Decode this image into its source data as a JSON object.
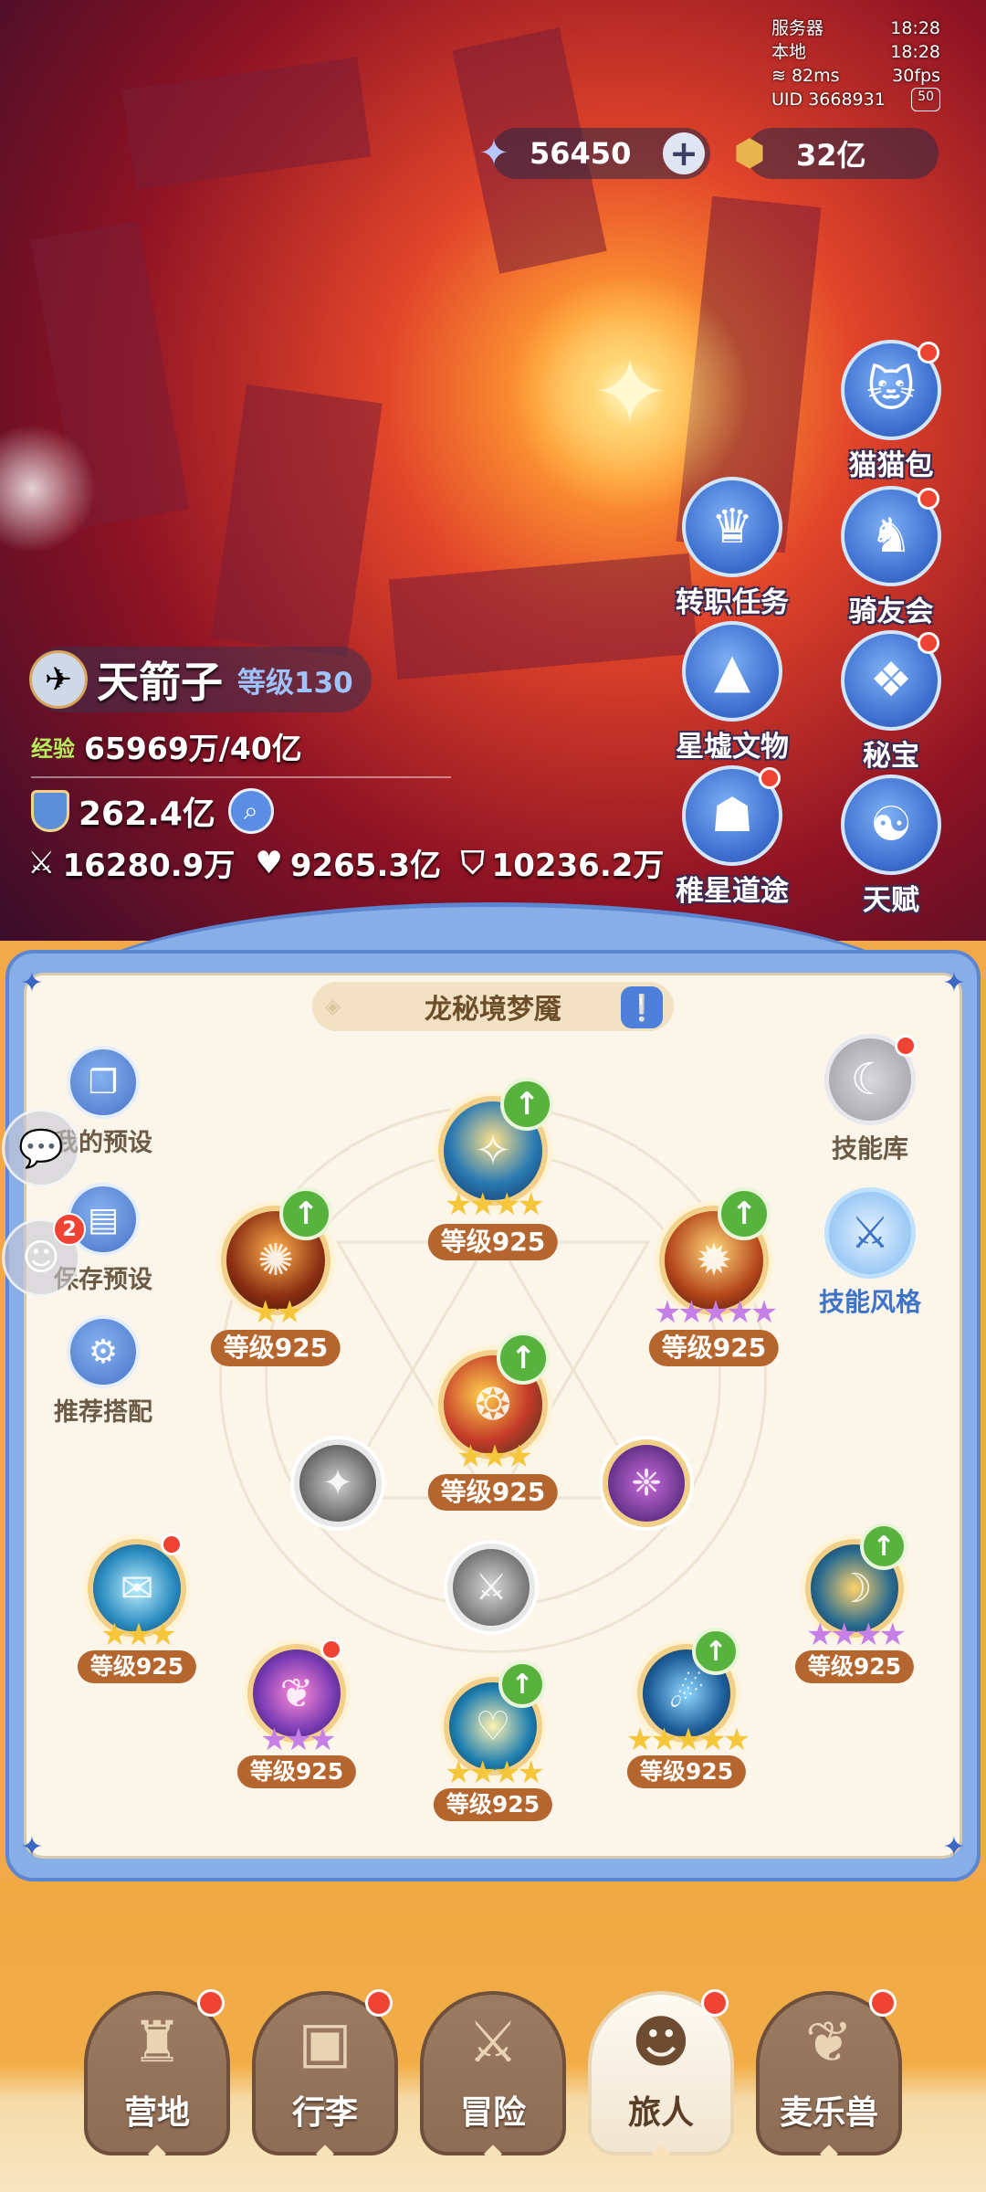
{
  "status": {
    "server_label": "服务器",
    "server_time": "18:28",
    "local_label": "本地",
    "local_time": "18:28",
    "ping": "82ms",
    "fps": "30fps",
    "uid": "UID 3668931",
    "fps_badge": "50"
  },
  "currency": {
    "stars": "56450",
    "gold": "32亿"
  },
  "side_menu": {
    "cat_bag": "猫猫包",
    "job_quest": "转职任务",
    "rider_club": "骑友会",
    "star_relic": "星墟文物",
    "treasure": "秘宝",
    "star_path": "稚星道途",
    "talent": "天赋"
  },
  "character": {
    "name": "天箭子",
    "level": "等级130",
    "exp_label": "经验",
    "exp_value": "65969万/40亿",
    "power": "262.4亿",
    "attack": "16280.9万",
    "hp": "9265.3亿",
    "defense": "10236.2万"
  },
  "panel": {
    "title": "龙秘境梦魇",
    "my_preset": "我的预设",
    "save_preset": "保存预设",
    "save_badge": "2",
    "recommend": "推荐搭配",
    "skill_library": "技能库",
    "skill_style": "技能风格"
  },
  "skills": [
    {
      "level": "等级925"
    },
    {
      "level": "等级925"
    },
    {
      "level": "等级925"
    },
    {
      "level": "等级925"
    },
    {
      "level": "等级925"
    },
    {
      "level": "等级925"
    },
    {
      "level": "等级925"
    },
    {
      "level": "等级925"
    },
    {
      "level": "等级925"
    }
  ],
  "nav": {
    "camp": "营地",
    "luggage": "行李",
    "adventure": "冒险",
    "traveler": "旅人",
    "pets": "麦乐兽"
  },
  "colors": {
    "accent_blue": "#5d86d1",
    "level_badge": "#b5662f",
    "notify_red": "#ef4334",
    "upgrade_green": "#58b23e",
    "gold_star": "#f5c63a",
    "purple_star": "#c77fe8"
  },
  "icons": {
    "star_currency": "star-crystal-icon",
    "gold_currency": "gold-coin-icon",
    "attack": "crossed-swords-icon",
    "hp": "heart-icon",
    "defense": "shield-icon"
  }
}
